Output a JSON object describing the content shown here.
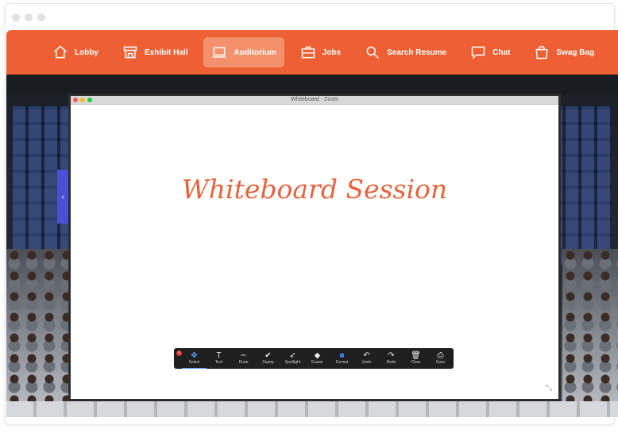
{
  "nav": {
    "items": [
      {
        "label": "Lobby",
        "icon": "home-icon",
        "active": false
      },
      {
        "label": "Exhibit Hall",
        "icon": "store-icon",
        "active": false
      },
      {
        "label": "Auditorium",
        "icon": "laptop-icon",
        "active": true
      },
      {
        "label": "Jobs",
        "icon": "briefcase-icon",
        "active": false
      },
      {
        "label": "Search Resume",
        "icon": "search-icon",
        "active": false
      },
      {
        "label": "Chat",
        "icon": "chat-icon",
        "active": false
      },
      {
        "label": "Swag Bag",
        "icon": "bag-icon",
        "active": false
      }
    ]
  },
  "zoom": {
    "window_title": "Whiteboard - Zoom",
    "heading": "Whiteboard Session",
    "toolbar": [
      {
        "label": "Select",
        "glyph": "✥",
        "active": true
      },
      {
        "label": "Text",
        "glyph": "T",
        "active": false
      },
      {
        "label": "Draw",
        "glyph": "∼",
        "active": false
      },
      {
        "label": "Stamp",
        "glyph": "✔",
        "active": false
      },
      {
        "label": "Spotlight",
        "glyph": "➶",
        "active": false
      },
      {
        "label": "Eraser",
        "glyph": "◆",
        "active": false
      },
      {
        "label": "Format",
        "glyph": "■",
        "active": false
      },
      {
        "label": "Undo",
        "glyph": "↶",
        "active": false
      },
      {
        "label": "Redo",
        "glyph": "↷",
        "active": false
      },
      {
        "label": "Clear",
        "glyph": "🗑",
        "active": false
      },
      {
        "label": "Save",
        "glyph": "⎙",
        "active": false
      }
    ]
  },
  "colors": {
    "accent": "#ee6033",
    "active_nav": "#f4916c",
    "heading": "#e5643d"
  }
}
